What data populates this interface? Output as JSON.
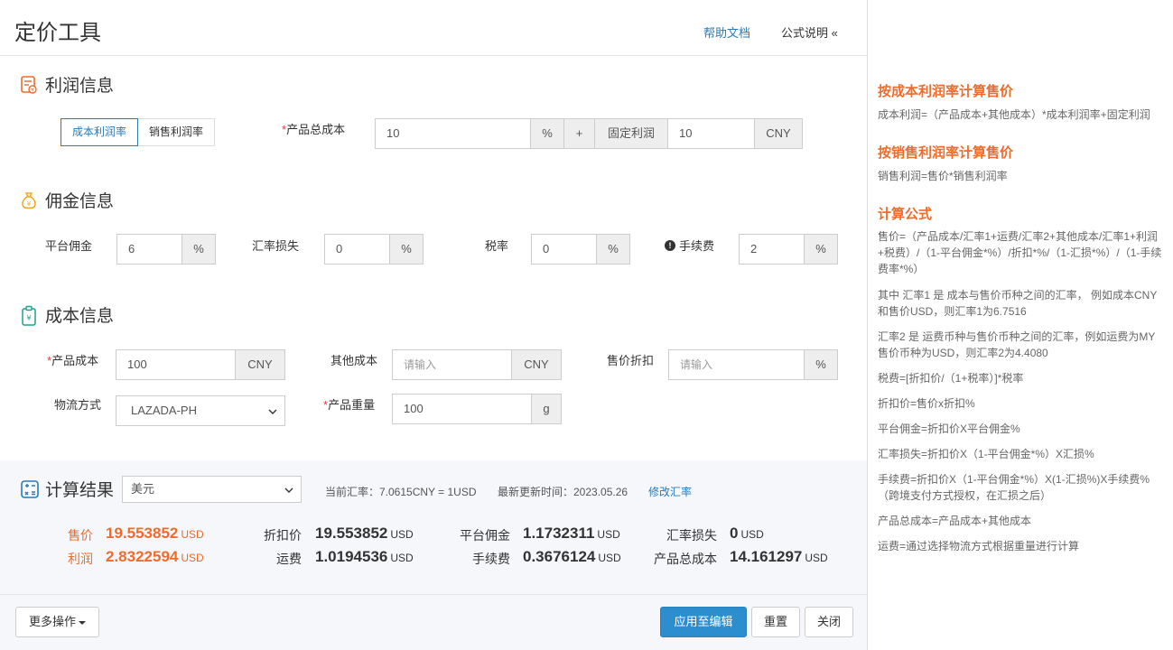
{
  "header": {
    "title": "定价工具",
    "help_link": "帮助文档",
    "formula_link": "公式说明 «"
  },
  "profit": {
    "section_title": "利润信息",
    "toggle": [
      "成本利润率",
      "销售利润率"
    ],
    "total_cost_label": "产品总成本",
    "required_mark": "*",
    "total_cost_value": "10",
    "percent": "%",
    "plus": "+",
    "fixed_profit_label": "固定利润",
    "fixed_profit_value": "10",
    "currency": "CNY"
  },
  "commission": {
    "section_title": "佣金信息",
    "platform_label": "平台佣金",
    "platform_value": "6",
    "fx_loss_label": "汇率损失",
    "fx_loss_value": "0",
    "tax_label": "税率",
    "tax_value": "0",
    "fee_label": "手续费",
    "fee_value": "2",
    "unit": "%"
  },
  "cost": {
    "section_title": "成本信息",
    "product_cost_label": "产品成本",
    "product_cost_value": "100",
    "product_cost_unit": "CNY",
    "other_cost_label": "其他成本",
    "other_cost_placeholder": "请输入",
    "other_cost_unit": "CNY",
    "discount_label": "售价折扣",
    "discount_placeholder": "请输入",
    "discount_unit": "%",
    "logistics_label": "物流方式",
    "logistics_value": "LAZADA-PH",
    "weight_label": "产品重量",
    "weight_value": "100",
    "weight_unit": "g"
  },
  "result": {
    "section_title": "计算结果",
    "currency_select": "美元",
    "current_rate": "当前汇率：7.0615CNY = 1USD",
    "updated_time": "最新更新时间：2023.05.26",
    "modify_rate": "修改汇率",
    "unit": "USD",
    "items": {
      "price": {
        "label": "售价",
        "value": "19.553852"
      },
      "profit": {
        "label": "利润",
        "value": "2.8322594"
      },
      "discount_price": {
        "label": "折扣价",
        "value": "19.553852"
      },
      "shipping": {
        "label": "运费",
        "value": "1.0194536"
      },
      "platform_commission": {
        "label": "平台佣金",
        "value": "1.1732311"
      },
      "fee": {
        "label": "手续费",
        "value": "0.3676124"
      },
      "fx_loss": {
        "label": "汇率损失",
        "value": "0"
      },
      "total_cost": {
        "label": "产品总成本",
        "value": "14.161297"
      }
    }
  },
  "footer": {
    "more": "更多操作",
    "apply": "应用至编辑",
    "reset": "重置",
    "close": "关闭"
  },
  "side": {
    "h1": "按成本利润率计算售价",
    "p1": "成本利润=（产品成本+其他成本）*成本利润率+固定利润",
    "h2": "按销售利润率计算售价",
    "p2": "销售利润=售价*销售利润率",
    "h3": "计算公式",
    "p3": "售价=（产品成本/汇率1+运费/汇率2+其他成本/汇率1+利润+税费）/（1-平台佣金*%）/折扣*%/（1-汇损*%）/（1-手续费率*%）",
    "p4": "其中 汇率1 是 成本与售价币种之间的汇率， 例如成本CNY和售价USD，则汇率1为6.7516",
    "p5": "汇率2 是 运费币种与售价币种之间的汇率，例如运费为MY售价币种为USD，则汇率2为4.4080",
    "p6": "税费=[折扣价/（1+税率）]*税率",
    "p7": "折扣价=售价x折扣%",
    "p8": "平台佣金=折扣价X平台佣金%",
    "p9": "汇率损失=折扣价X（1-平台佣金*%）X汇损%",
    "p10": "手续费=折扣价X（1-平台佣金*%）X(1-汇损%)X手续费%（跨境支付方式授权，在汇损之后）",
    "p11": "产品总成本=产品成本+其他成本",
    "p12": "运费=通过选择物流方式根据重量进行计算"
  },
  "colors": {
    "accent": "#2a7ab8",
    "orange": "#f06b2b",
    "primary_button": "#2d8ecf"
  }
}
